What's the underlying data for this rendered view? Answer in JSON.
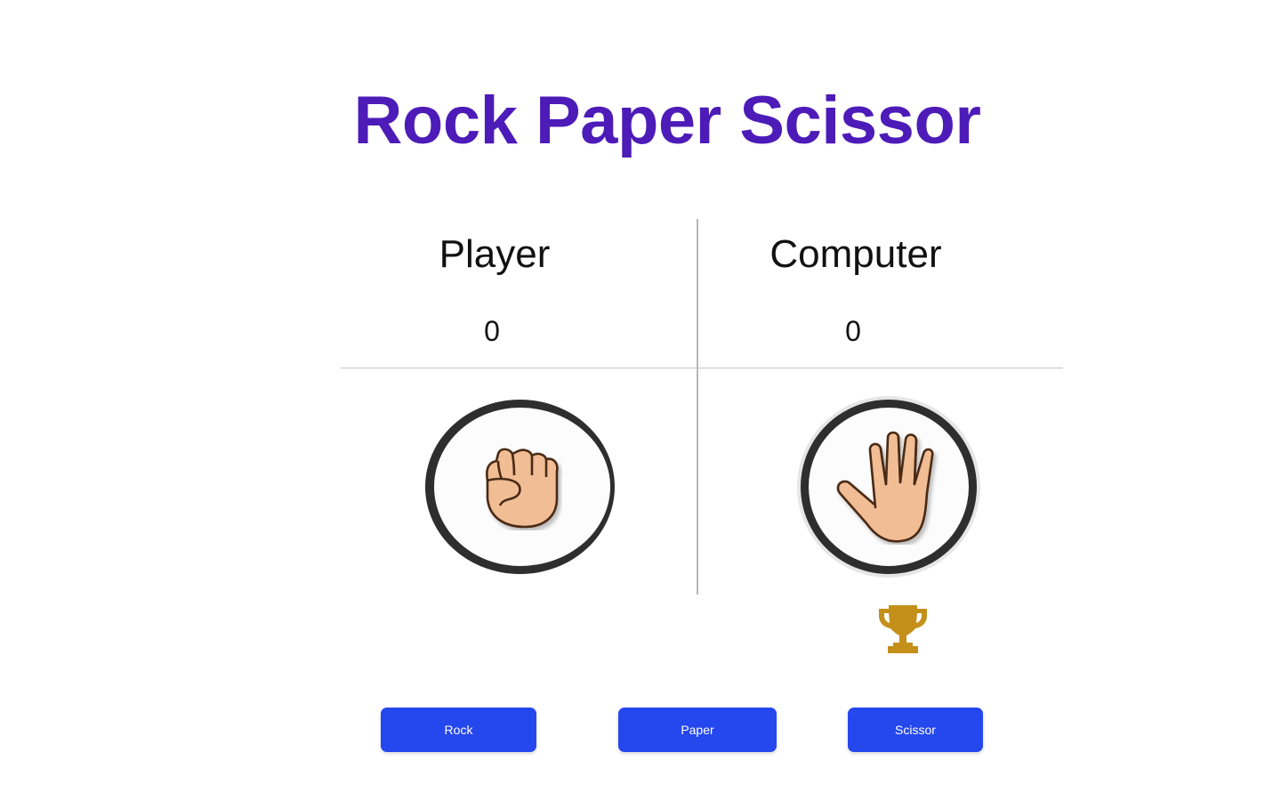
{
  "title": "Rock Paper Scissor",
  "player": {
    "label": "Player",
    "score": "0",
    "choice_icon": "fist-icon"
  },
  "computer": {
    "label": "Computer",
    "score": "0",
    "choice_icon": "raised-hand-icon",
    "round_winner_icon": "trophy-icon"
  },
  "buttons": {
    "rock": "Rock",
    "paper": "Paper",
    "scissor": "Scissor"
  },
  "colors": {
    "title": "#4d1bb8",
    "button": "#2547ee",
    "trophy": "#c4901a",
    "skin": "#f1bd94"
  }
}
